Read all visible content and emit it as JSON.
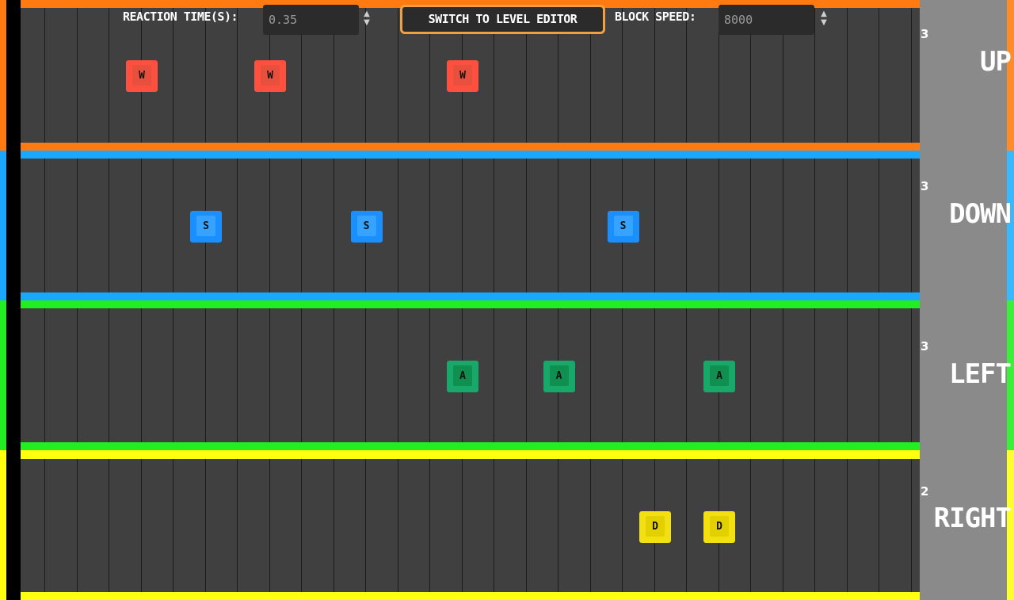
{
  "toolbar": {
    "reaction_time_label": "REACTION TIME(S):",
    "reaction_time_value": "0.35",
    "switch_button_label": "SWITCH TO LEVEL EDITOR",
    "block_speed_label": "BLOCK SPEED:",
    "block_speed_value": "8000",
    "spinner_icon": "up-down-arrows"
  },
  "lanes": [
    {
      "label": "UP",
      "count": "3",
      "key": "W",
      "color": "#ff7a10",
      "block_color": "#ff4f3e",
      "block_face": "#e8503e"
    },
    {
      "label": "DOWN",
      "count": "3",
      "key": "S",
      "color": "#1aa8ff",
      "block_color": "#1a8fff",
      "block_face": "#35a3ff"
    },
    {
      "label": "LEFT",
      "count": "3",
      "key": "A",
      "color": "#22ee22",
      "block_color": "#18a86a",
      "block_face": "#109050"
    },
    {
      "label": "RIGHT",
      "count": "2",
      "key": "D",
      "color": "#ffff10",
      "block_color": "#f2e010",
      "block_face": "#e3d000"
    }
  ],
  "grid": {
    "columns": 28
  },
  "notes": {
    "up": [
      2,
      6,
      12
    ],
    "down": [
      4,
      9,
      17
    ],
    "left": [
      12,
      15,
      20
    ],
    "right": [
      18,
      20
    ]
  }
}
